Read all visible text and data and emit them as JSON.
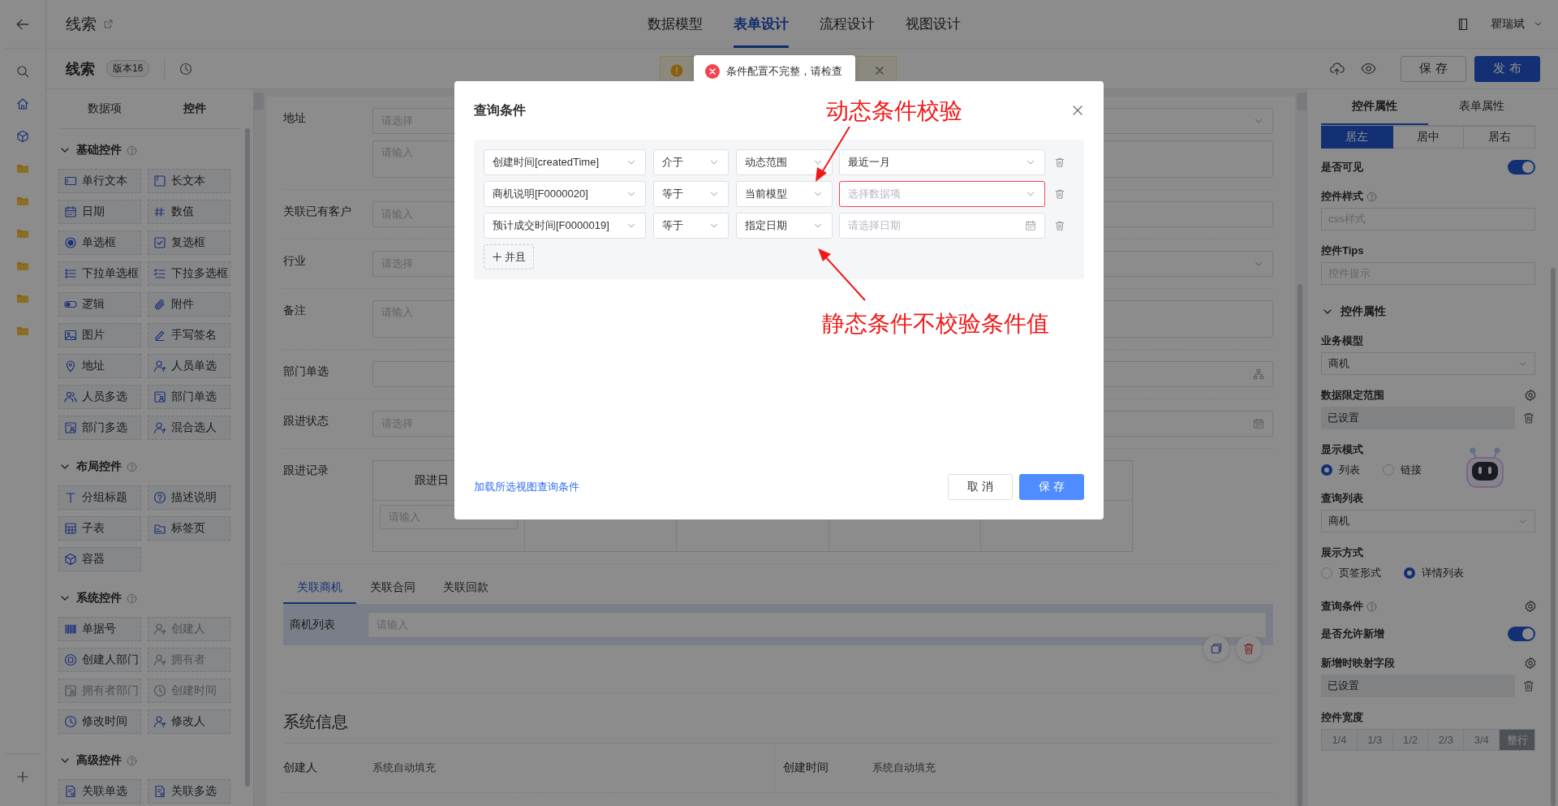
{
  "app_title": "线索",
  "nav_tabs": [
    {
      "label": "数据模型",
      "selected": false
    },
    {
      "label": "表单设计",
      "selected": true
    },
    {
      "label": "流程设计",
      "selected": false
    },
    {
      "label": "视图设计",
      "selected": false
    }
  ],
  "user": {
    "name": "瞿瑞斌"
  },
  "toolbar": {
    "title": "线索",
    "version": "版本16",
    "buttons": [
      {
        "label": "保 存",
        "kind": "secondary"
      },
      {
        "label": "发 布",
        "kind": "primary"
      }
    ]
  },
  "toast": {
    "message": "条件配置不完整，请检查"
  },
  "palette": {
    "tabs": [
      {
        "label": "数据项",
        "selected": false
      },
      {
        "label": "控件",
        "selected": true
      }
    ],
    "groups": [
      {
        "title": "基础控件",
        "expanded": true,
        "items": [
          {
            "label": "单行文本",
            "disabled": false
          },
          {
            "label": "长文本",
            "disabled": false
          },
          {
            "label": "日期",
            "disabled": false
          },
          {
            "label": "数值",
            "disabled": false
          },
          {
            "label": "单选框",
            "disabled": false
          },
          {
            "label": "复选框",
            "disabled": false
          },
          {
            "label": "下拉单选框",
            "disabled": false
          },
          {
            "label": "下拉多选框",
            "disabled": false
          },
          {
            "label": "逻辑",
            "disabled": false
          },
          {
            "label": "附件",
            "disabled": false
          },
          {
            "label": "图片",
            "disabled": false
          },
          {
            "label": "手写签名",
            "disabled": false
          },
          {
            "label": "地址",
            "disabled": false
          },
          {
            "label": "人员单选",
            "disabled": false
          },
          {
            "label": "人员多选",
            "disabled": false
          },
          {
            "label": "部门单选",
            "disabled": false
          },
          {
            "label": "部门多选",
            "disabled": false
          },
          {
            "label": "混合选人",
            "disabled": false
          }
        ]
      },
      {
        "title": "布局控件",
        "expanded": true,
        "items": [
          {
            "label": "分组标题",
            "disabled": false
          },
          {
            "label": "描述说明",
            "disabled": false
          },
          {
            "label": "子表",
            "disabled": false
          },
          {
            "label": "标签页",
            "disabled": false
          },
          {
            "label": "容器",
            "disabled": false
          }
        ]
      },
      {
        "title": "系统控件",
        "expanded": true,
        "items": [
          {
            "label": "单据号",
            "disabled": false
          },
          {
            "label": "创建人",
            "disabled": true
          },
          {
            "label": "创建人部门",
            "disabled": false
          },
          {
            "label": "拥有者",
            "disabled": true
          },
          {
            "label": "拥有者部门",
            "disabled": true
          },
          {
            "label": "创建时间",
            "disabled": true
          },
          {
            "label": "修改时间",
            "disabled": false
          },
          {
            "label": "修改人",
            "disabled": false
          }
        ]
      },
      {
        "title": "高级控件",
        "expanded": true,
        "items": [
          {
            "label": "关联单选",
            "disabled": false
          },
          {
            "label": "关联多选",
            "disabled": false
          }
        ]
      }
    ]
  },
  "form": {
    "fields": [
      {
        "label": "地址",
        "controls": [
          {
            "kind": "select",
            "placeholder": "请选择"
          },
          {
            "kind": "textarea",
            "placeholder": "请输入"
          }
        ]
      },
      {
        "label": "关联已有客户",
        "controls": [
          {
            "kind": "input",
            "placeholder": "请输入"
          }
        ]
      },
      {
        "label": "行业",
        "controls": [
          {
            "kind": "select",
            "placeholder": "请选择"
          }
        ]
      },
      {
        "label": "备注",
        "controls": [
          {
            "kind": "textarea",
            "placeholder": "请输入"
          }
        ]
      },
      {
        "label": "部门单选",
        "controls": [
          {
            "kind": "org"
          }
        ]
      },
      {
        "label": "跟进状态",
        "controls": [
          {
            "kind": "date",
            "placeholder": "请选择"
          }
        ]
      },
      {
        "label": "跟进记录",
        "controls": [
          {
            "kind": "subtable",
            "column": "跟进日",
            "placeholder": "请输入"
          }
        ]
      }
    ],
    "tabs": [
      {
        "label": "关联商机",
        "selected": true
      },
      {
        "label": "关联合同",
        "selected": false
      },
      {
        "label": "关联回款",
        "selected": false
      }
    ],
    "related": {
      "label": "商机列表",
      "placeholder": "请输入"
    },
    "system": {
      "title": "系统信息",
      "fields": [
        {
          "label": "创建人",
          "value": "系统自动填充"
        },
        {
          "label": "创建时间",
          "value": "系统自动填充"
        }
      ]
    }
  },
  "properties": {
    "tabs": [
      {
        "label": "控件属性",
        "selected": true
      },
      {
        "label": "表单属性",
        "selected": false
      }
    ],
    "alignment": [
      {
        "label": "居左",
        "selected": true
      },
      {
        "label": "居中",
        "selected": false
      },
      {
        "label": "居右",
        "selected": false
      }
    ],
    "items": [
      {
        "kind": "toggle",
        "label": "是否可见",
        "help": false,
        "on": true
      },
      {
        "kind": "input",
        "label": "控件样式",
        "help": true,
        "placeholder": "css样式"
      },
      {
        "kind": "input",
        "label": "控件Tips",
        "help": false,
        "placeholder": "控件提示"
      },
      {
        "kind": "section",
        "label": "控件属性",
        "help": false,
        "expanded": true
      },
      {
        "kind": "select",
        "label": "业务模型",
        "help": false,
        "value": "商机"
      },
      {
        "kind": "setting",
        "label": "数据限定范围",
        "help": false,
        "value": "已设置"
      },
      {
        "kind": "radio",
        "label": "显示模式",
        "help": false,
        "options": [
          {
            "label": "列表",
            "selected": true
          },
          {
            "label": "链接",
            "selected": false
          }
        ]
      },
      {
        "kind": "select",
        "label": "查询列表",
        "help": false,
        "value": "商机"
      },
      {
        "kind": "radio",
        "label": "展示方式",
        "help": false,
        "options": [
          {
            "label": "页签形式",
            "selected": false
          },
          {
            "label": "详情列表",
            "selected": true
          }
        ]
      },
      {
        "kind": "gear",
        "label": "查询条件",
        "help": true
      },
      {
        "kind": "toggle",
        "label": "是否允许新增",
        "help": false,
        "on": true
      },
      {
        "kind": "setting",
        "label": "新增时映射字段",
        "help": false,
        "value": "已设置"
      },
      {
        "kind": "segmented",
        "label": "控件宽度",
        "help": false,
        "disabled": true,
        "options": [
          {
            "label": "1/4",
            "selected": false
          },
          {
            "label": "1/3",
            "selected": false
          },
          {
            "label": "1/2",
            "selected": false
          },
          {
            "label": "2/3",
            "selected": false
          },
          {
            "label": "3/4",
            "selected": false
          },
          {
            "label": "整行",
            "selected": true
          }
        ]
      }
    ]
  },
  "dialog": {
    "title": "查询条件",
    "conditions": [
      {
        "field": "创建时间[createdTime]",
        "operator": "介于",
        "value_type": "动态范围",
        "value": {
          "kind": "select",
          "text": "最近一月"
        },
        "error": false
      },
      {
        "field": "商机说明[F0000020]",
        "operator": "等于",
        "value_type": "当前模型",
        "value": {
          "kind": "select",
          "placeholder": "选择数据项"
        },
        "error": true
      },
      {
        "field": "预计成交时间[F0000019]",
        "operator": "等于",
        "value_type": "指定日期",
        "value": {
          "kind": "date",
          "placeholder": "请选择日期"
        },
        "error": false
      }
    ],
    "add_button": "并且",
    "link": "加载所选视图查询条件",
    "buttons": [
      {
        "label": "取 消",
        "kind": "secondary"
      },
      {
        "label": "保 存",
        "kind": "primary"
      }
    ]
  },
  "annotations": [
    {
      "text": "动态条件校验"
    },
    {
      "text": "静态条件不校验条件值"
    }
  ]
}
